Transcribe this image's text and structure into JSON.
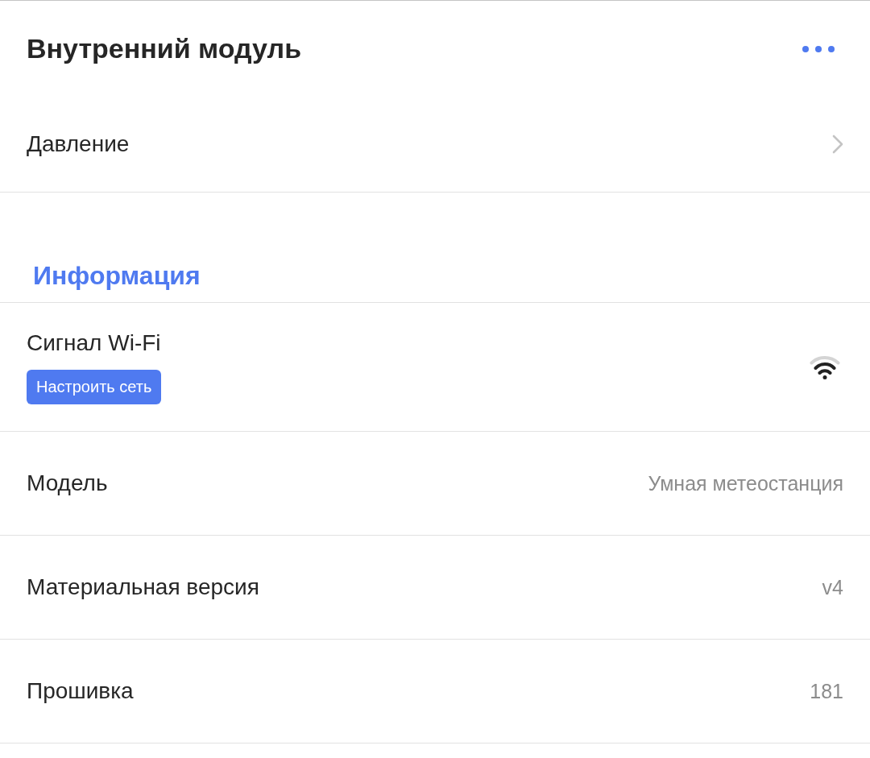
{
  "header": {
    "title": "Внутренний модуль"
  },
  "items": [
    {
      "kind": "link",
      "label": "Давление"
    }
  ],
  "info": {
    "title": "Информация",
    "items": [
      {
        "kind": "wifi",
        "label": "Сигнал Wi-Fi",
        "button": "Настроить сеть"
      },
      {
        "kind": "value",
        "label": "Модель",
        "value": "Умная метеостанция"
      },
      {
        "kind": "value",
        "label": "Материальная версия",
        "value": "v4"
      },
      {
        "kind": "value",
        "label": "Прошивка",
        "value": "181"
      }
    ]
  }
}
